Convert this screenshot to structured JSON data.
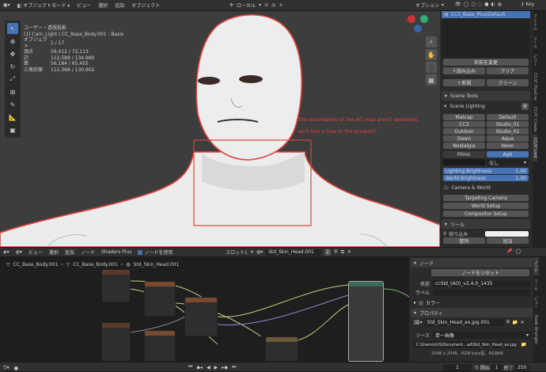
{
  "top_menu": {
    "mode": "オブジェクトモード",
    "items": [
      "ビュー",
      "選択",
      "追加",
      "オブジェクト"
    ],
    "transform_space": "ローカル",
    "options_label": "オプション",
    "scene_key": "Key"
  },
  "viewport_info": {
    "view": "ユーザー・透視投影",
    "context": "(1) Cam_Light | CC_Base_Body.001 : Basis",
    "rows": [
      {
        "label": "オブジェクト",
        "value": "1 / 17"
      },
      {
        "label": "頂点",
        "value": "56,412 / 72,113"
      },
      {
        "label": "辺",
        "value": "112,588 / 134,980"
      },
      {
        "label": "面",
        "value": "56,184 / 65,455"
      },
      {
        "label": "三角形面",
        "value": "112,368 / 130,902"
      }
    ]
  },
  "annotation": {
    "line1": "The boundaries of the AO map aren't seamless.",
    "line2": "Isn't this a flaw in the product?",
    "color": "#e0443c"
  },
  "sidebar": {
    "list_item": "CC3_Base_Plus|Default",
    "buttons": {
      "rename": "名前を変更",
      "load": "読み込み",
      "clear": "クリア",
      "new": "新規",
      "clean": "クリーン"
    },
    "scene_tools": {
      "title": "Scene Tools",
      "lighting_title": "Scene Lighting",
      "grid": [
        [
          "Matcap",
          "Default"
        ],
        [
          "CC3",
          "Studio_01"
        ],
        [
          "Outdoor",
          "Studio_02"
        ],
        [
          "Dawn",
          "Aqua"
        ],
        [
          "Nostalgia",
          "Neon"
        ]
      ],
      "filmic": "Filmic",
      "agx": "AgX",
      "none": "なし",
      "lighting_brightness": {
        "label": "Lighting Brightness",
        "value": "1.00"
      },
      "world_brightness": {
        "label": "World Brightness",
        "value": "1.00"
      },
      "camera_world": "Camera & World",
      "targeting_camera": "Targeting Camera",
      "world_setup": "World Setup",
      "compositor_setup": "Compositor Setup"
    },
    "tool_panel": {
      "title": "ツール",
      "filter": "絞り込み",
      "align": "整列",
      "add": "追加"
    },
    "tabs": [
      "アイテム",
      "ツール",
      "ビュー",
      "CC/iC Pipeline",
      "CC/iC Create",
      "CC/iC Link"
    ]
  },
  "node_editor": {
    "menu": [
      "ビュー",
      "選択",
      "追加",
      "ノード"
    ],
    "shaders_plus": "Shaders Plus",
    "use_nodes": "ノードを使用",
    "slot": "スロット1",
    "material": "Std_Skin_Head.001",
    "users": "2",
    "breadcrumb": [
      "CC_Base_Body.001",
      "CC_Base_Body.001",
      "Std_Skin_Head.001"
    ]
  },
  "node_props": {
    "node_title": "ノード",
    "reset": "ノードをリセット",
    "name_label": "名前",
    "name_value": "ccSId_(AO)_v2.4.0_1435",
    "label_label": "ラベル",
    "color": "カラー",
    "properties": "プロパティ",
    "image": "Std_Skin_Head_ao.jpg.001",
    "source_label": "ソース",
    "source_value": "単一画像",
    "path": "C:\\Users\\chS\\Document...ad\\Std_Skin_Head_ao.jpg",
    "info": "2048 x 2048、RGB byte型、RGBA8",
    "tabs": [
      "ノード",
      "ツール",
      "ビュー",
      "Node Wrangler"
    ]
  },
  "timeline": {
    "frame": "1",
    "start_label": "開始",
    "start": "1",
    "end_label": "終了",
    "end": "250"
  },
  "colors": {
    "accent": "#4772b3",
    "node_header": "#7a4a2f",
    "node_header_dark": "#5a3a2a",
    "selection": "#e0443c"
  }
}
